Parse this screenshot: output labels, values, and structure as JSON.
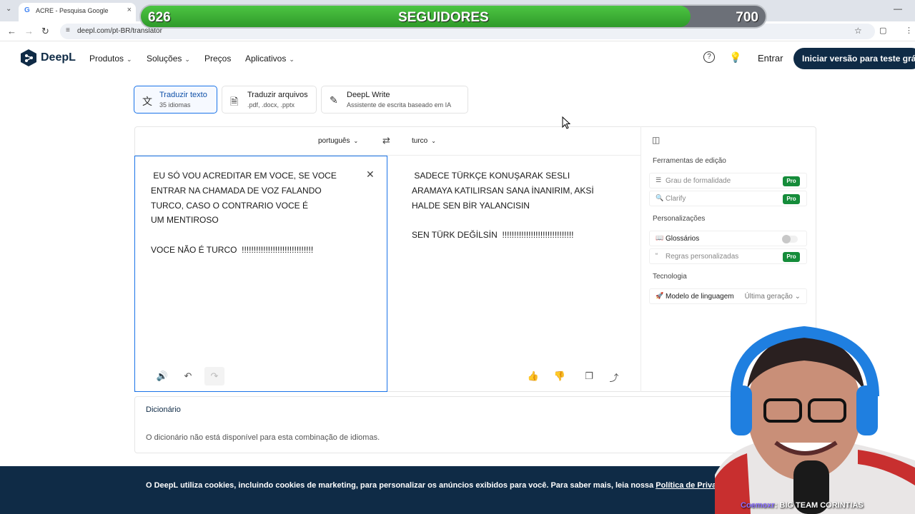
{
  "browser": {
    "tab_title": "ACRE - Pesquisa Google",
    "tab_favicon": "G",
    "tab_close": "×",
    "url": "deepl.com/pt-BR/translator"
  },
  "overlay": {
    "current": "626",
    "label": "SEGUIDORES",
    "goal": "700",
    "progress_fraction": 0.88,
    "caption_user": "Coemoxr",
    "caption_text": ": BIG TEAM CORINTIAS"
  },
  "header": {
    "brand": "DeepL",
    "nav": [
      {
        "label": "Produtos",
        "dropdown": true
      },
      {
        "label": "Soluções",
        "dropdown": true
      },
      {
        "label": "Preços",
        "dropdown": false
      },
      {
        "label": "Aplicativos",
        "dropdown": true
      }
    ],
    "login": "Entrar",
    "trial": "Iniciar versão para teste grát"
  },
  "modes": [
    {
      "title": "Traduzir texto",
      "subtitle": "35 idiomas",
      "icon": "translate-icon",
      "active": true
    },
    {
      "title": "Traduzir arquivos",
      "subtitle": ".pdf, .docx, .pptx",
      "icon": "file-icon",
      "active": false
    },
    {
      "title": "DeepL Write",
      "subtitle": "Assistente de escrita baseado em IA",
      "icon": "magic-pen-icon",
      "active": false
    }
  ],
  "translator": {
    "source_lang": "português",
    "target_lang": "turco",
    "source_text": " EU SÓ VOU ACREDITAR EM VOCE, SE VOCE\nENTRAR NA CHAMADA DE VOZ FALANDO\nTURCO, CASO O CONTRARIO VOCE É\nUM MENTIROSO\n\nVOCE NÃO É TURCO  !!!!!!!!!!!!!!!!!!!!!!!!!!!!!!",
    "target_text": " SADECE TÜRKÇE KONUŞARAK SESLI\nARAMAYA KATILIRSAN SANA İNANIRIM, AKSİ\nHALDE SEN BİR YALANCISIN\n\nSEN TÜRK DEĞİLSİN  !!!!!!!!!!!!!!!!!!!!!!!!!!!!!!"
  },
  "sidebar": {
    "section_editing": "Ferramentas de edição",
    "formality": "Grau de formalidade",
    "clarify": "Clarify",
    "section_custom": "Personalizações",
    "glossaries": "Glossários",
    "custom_rules": "Regras personalizadas",
    "section_tech": "Tecnologia",
    "model_label": "Modelo de linguagem",
    "model_value": "Última geração",
    "pro_badge": "Pro"
  },
  "dictionary": {
    "title": "Dicionário",
    "message": "O dicionário não está disponível para esta combinação de idiomas."
  },
  "cookie": {
    "text": "O DeepL utiliza cookies, incluindo cookies de marketing, para personalizar os anúncios exibidos para você. Para saber mais, leia nossa ",
    "link": "Política de Privacidade"
  },
  "colors": {
    "brand_navy": "#0f2b46",
    "accent_blue": "#1a73e8",
    "pro_green": "#158c3a",
    "progress_green": "#4cc542"
  }
}
